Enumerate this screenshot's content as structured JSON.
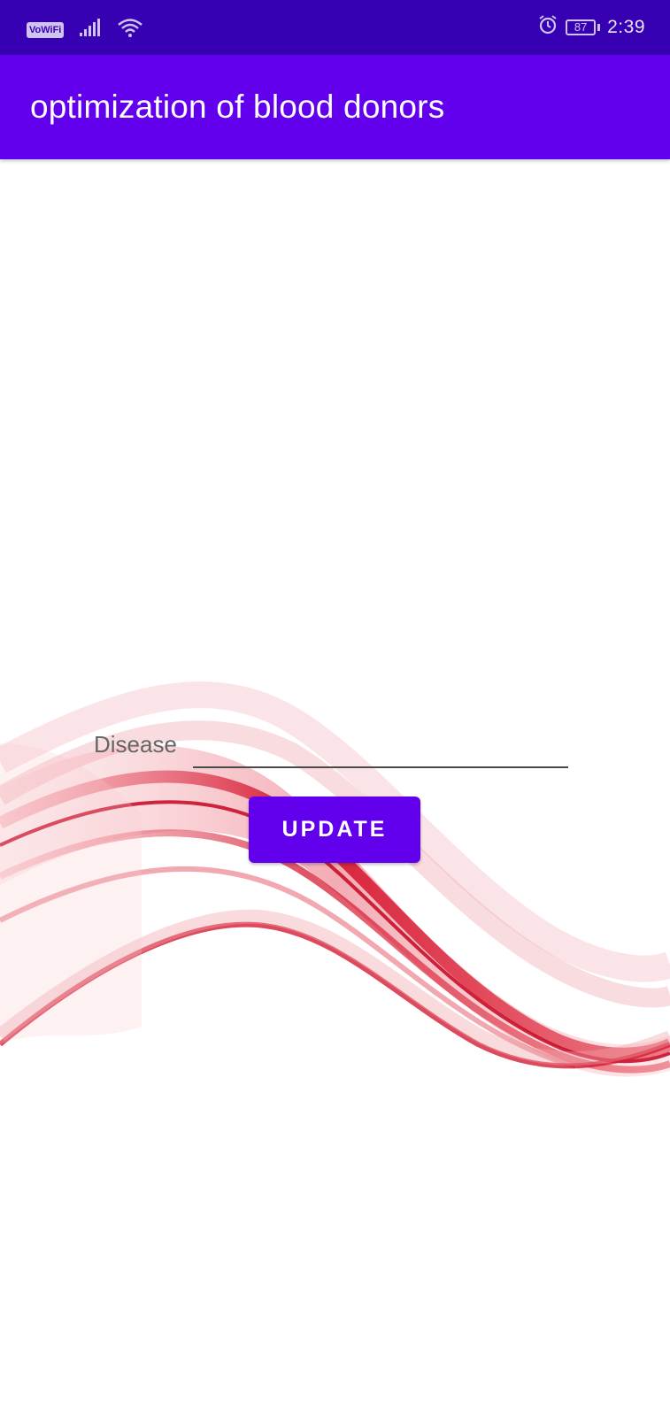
{
  "status_bar": {
    "vowifi_label": "VoWiFi",
    "battery_level": "87",
    "time": "2:39",
    "icons": [
      "signal-icon",
      "wifi-icon",
      "alarm-icon",
      "battery-icon"
    ],
    "background_color": "#3700b3"
  },
  "app_bar": {
    "title": "optimization of blood donors",
    "background_color": "#6200ee"
  },
  "form": {
    "disease_label": "Disease",
    "disease_value": "",
    "update_button_label": "UPDATE"
  },
  "background_image": "red-wave-decoration"
}
